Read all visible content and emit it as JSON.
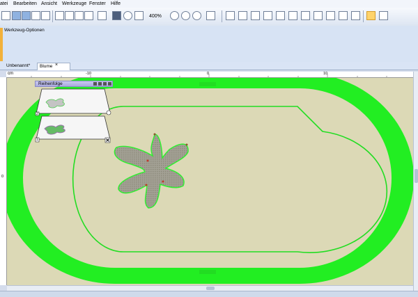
{
  "menu": [
    "atei",
    "Bearbeiten",
    "Ansicht",
    "Werkzeuge",
    "Fenster",
    "Hilfe"
  ],
  "toolbar": {
    "zoom": "400%"
  },
  "tool_options": {
    "title": "Werkzeug-Optionen"
  },
  "tabs": [
    {
      "label": "Unbenannt*"
    },
    {
      "label": "Blume"
    }
  ],
  "tab_close": "×",
  "ruler": {
    "unit": "cm",
    "ticks": [
      "-10",
      "0",
      "10"
    ],
    "vticks": [
      "0"
    ]
  },
  "panel": {
    "title": "Reihenfolge",
    "items": [
      {
        "num": "2"
      },
      {
        "num": "1"
      }
    ]
  },
  "colors": {
    "track": "#22ee22",
    "inner_line": "#22dd22",
    "canvas_bg": "#dcd9b6",
    "flower_fill": "#a3a195",
    "flower_outline": "#33ee33",
    "panel_header": "#b3b3e6"
  }
}
